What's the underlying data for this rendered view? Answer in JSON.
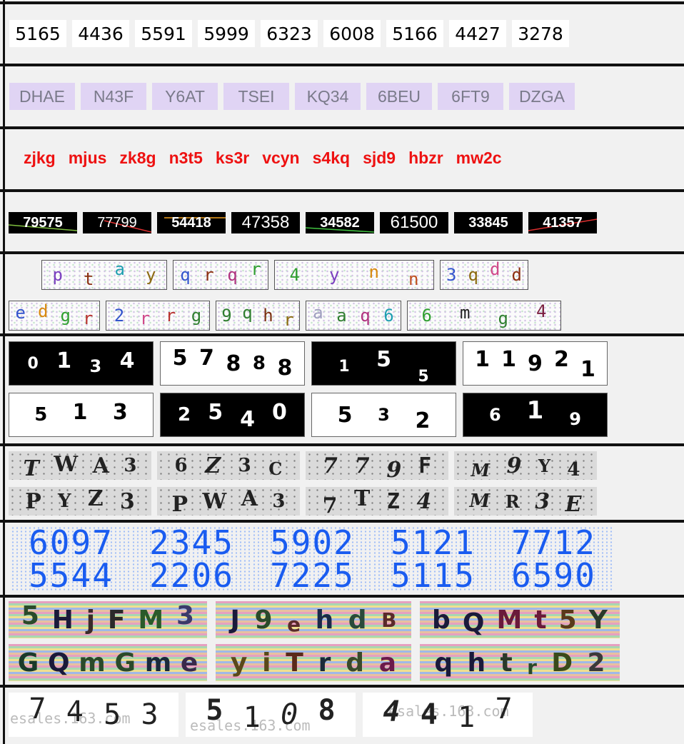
{
  "row1": {
    "codes": [
      "5165",
      "4436",
      "5591",
      "5999",
      "6323",
      "6008",
      "5166",
      "4427",
      "3278"
    ]
  },
  "row2": {
    "codes": [
      "DHAE",
      "N43F",
      "Y6AT",
      "TSEI",
      "KQ34",
      "6BEU",
      "6FT9",
      "DZGA"
    ]
  },
  "row3": {
    "codes": [
      "zjkg",
      "mjus",
      "zk8g",
      "n3t5",
      "ks3r",
      "vcyn",
      "s4kq",
      "sjd9",
      "hbzr",
      "mw2c"
    ]
  },
  "row4": {
    "codes": [
      "79575",
      "77799",
      "54418",
      "47358",
      "34582",
      "61500",
      "33845",
      "41357"
    ]
  },
  "row5": {
    "line1": [
      [
        "p",
        "t",
        "a",
        "y"
      ],
      [
        "q",
        "r",
        "q",
        "r"
      ],
      [
        "4",
        "y",
        "n",
        "n"
      ],
      [
        "3",
        "q",
        "d",
        "d"
      ]
    ],
    "line2": [
      [
        "e",
        "d",
        "g",
        "r"
      ],
      [
        "2",
        "r",
        "r",
        "g"
      ],
      [
        "9",
        "q",
        "h",
        "r"
      ],
      [
        "a",
        "a",
        "q",
        "6"
      ],
      [
        "6",
        "m",
        "g",
        "4"
      ]
    ]
  },
  "row6": {
    "line1": [
      [
        "0",
        "1",
        "3",
        "4"
      ],
      [
        "5",
        "7",
        "8",
        "8",
        "8"
      ],
      [
        "1",
        "5",
        "5"
      ],
      [
        "1",
        "1",
        "9",
        "2",
        "1"
      ]
    ],
    "line2": [
      [
        "5",
        "1",
        "3"
      ],
      [
        "2",
        "5",
        "4",
        "0"
      ],
      [
        "5",
        "3",
        "2"
      ],
      [
        "6",
        "1",
        "9"
      ]
    ]
  },
  "row7": {
    "line1": [
      [
        "T",
        "W",
        "A",
        "3"
      ],
      [
        "6",
        "Z",
        "3",
        "C"
      ],
      [
        "7",
        "7",
        "9",
        "F"
      ],
      [
        "M",
        "9",
        "Y",
        "4"
      ]
    ],
    "line2": [
      [
        "P",
        "Y",
        "Z",
        "3"
      ],
      [
        "P",
        "W",
        "A",
        "3"
      ],
      [
        "7",
        "T",
        "Z",
        "4"
      ],
      [
        "M",
        "R",
        "3",
        "E"
      ]
    ]
  },
  "row8": {
    "line1": [
      "6097",
      "2345",
      "5902",
      "5121",
      "7712"
    ],
    "line2": [
      "5544",
      "2206",
      "7225",
      "5115",
      "6590"
    ]
  },
  "row9": {
    "line1": [
      [
        "5",
        "H",
        "j",
        "F",
        "M",
        "3"
      ],
      [
        "J",
        "9",
        "e",
        "h",
        "d",
        "B"
      ],
      [
        "b",
        "Q",
        "M",
        "t",
        "5",
        "Y"
      ]
    ],
    "line2": [
      [
        "G",
        "Q",
        "m",
        "G",
        "m",
        "e"
      ],
      [
        "y",
        "i",
        "T",
        "r",
        "d",
        "a"
      ],
      [
        "q",
        "h",
        "t",
        "r",
        "D",
        "2"
      ]
    ]
  },
  "row10": {
    "codes": [
      [
        "7",
        "4",
        "5",
        "3"
      ],
      [
        "5",
        "1",
        "0",
        "8"
      ],
      [
        "4",
        "4",
        "1",
        "7"
      ]
    ],
    "watermarks": [
      "esales.163.com",
      "esales.163.com",
      "esales.163.com"
    ]
  },
  "colors": {
    "row2_bg": "#e0d4f4",
    "row3_text": "#ee1111",
    "row8_text": "#1a5cf0",
    "row5_chars": [
      "#7a3fbf",
      "#b8332f",
      "#1f9fb0",
      "#8b6a10",
      "#2f7f2f",
      "#d14a8a",
      "#3355cc"
    ]
  }
}
